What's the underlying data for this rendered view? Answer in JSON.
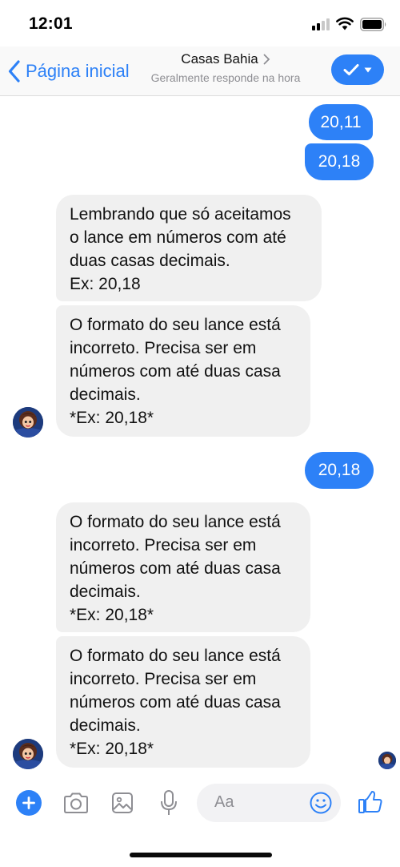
{
  "status_bar": {
    "time": "12:01"
  },
  "header": {
    "back_label": "Página inicial",
    "contact_name": "Casas Bahia",
    "contact_status": "Geralmente responde na hora",
    "accent_color": "#2d81f7"
  },
  "messages": [
    {
      "from": "me",
      "text": "20,11"
    },
    {
      "from": "me",
      "text": "20,18"
    },
    {
      "from": "bot",
      "lines": [
        "Lembrando que só aceitamos",
        "o lance em números com até",
        "duas casas decimais.",
        "Ex: 20,18"
      ]
    },
    {
      "from": "bot",
      "lines": [
        "O formato do seu lance está",
        "incorreto. Precisa ser em",
        "números com até duas casa",
        "decimais.",
        "*Ex: 20,18*"
      ]
    },
    {
      "from": "me",
      "text": "20,18"
    },
    {
      "from": "bot",
      "lines": [
        "O formato do seu lance está",
        "incorreto. Precisa ser em",
        "números com até duas casa",
        "decimais.",
        "*Ex: 20,18*"
      ]
    },
    {
      "from": "bot",
      "lines": [
        "O formato do seu lance está",
        "incorreto. Precisa ser em",
        "números com até duas casa",
        "decimais.",
        "*Ex: 20,18*"
      ]
    }
  ],
  "composer": {
    "placeholder": "Aa",
    "icons": [
      "plus-icon",
      "camera-icon",
      "image-icon",
      "microphone-icon",
      "emoji-icon",
      "thumbs-up-icon"
    ]
  }
}
